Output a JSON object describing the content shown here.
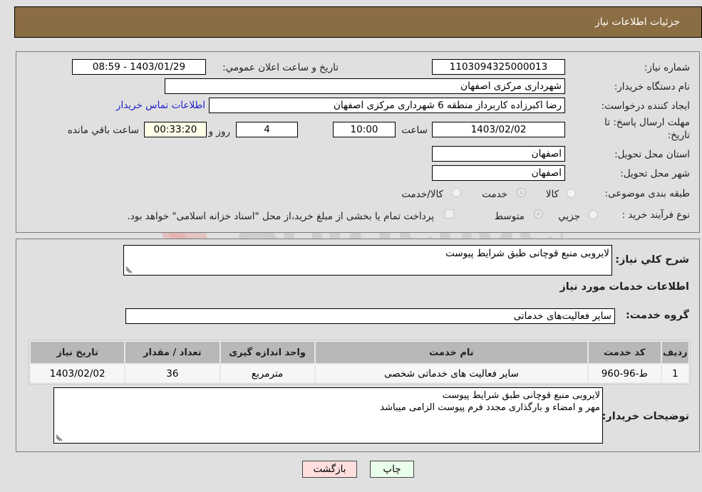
{
  "header": {
    "title": "جزئیات اطلاعات نیاز"
  },
  "form": {
    "need_number_label": "شماره نیاز:",
    "need_number": "1103094325000013",
    "announce_label": "تاريخ و ساعت اعلان عمومي:",
    "announce_value": "1403/01/29 - 08:59",
    "buyer_org_label": "نام دستگاه خريدار:",
    "buyer_org": "شهرداری مرکزی اصفهان",
    "creator_label": "ايجاد کننده درخواست:",
    "creator": "رضا اکبرزاده کاربرداز منطقه 6 شهرداری مرکزی اصفهان",
    "contact_link": "اطلاعات تماس خريدار",
    "deadline_label_1": "مهلت ارسال پاسخ: تا",
    "deadline_label_2": "تاريخ:",
    "deadline_date": "1403/02/02",
    "time_label": "ساعت",
    "deadline_time": "10:00",
    "days_value": "4",
    "days_label": "روز و",
    "remaining_time": "00:33:20",
    "remaining_label": "ساعت باقي مانده",
    "province_label": "استان محل تحويل:",
    "province": "اصفهان",
    "city_label": "شهر محل تحويل:",
    "city": "اصفهان",
    "category_label": "طبقه بندی موضوعی:",
    "category_options": [
      "کالا",
      "خدمت",
      "کالا/خدمت"
    ],
    "category_selected": "خدمت",
    "process_label": "نوع فرآيند خريد :",
    "process_options": [
      "جزيي",
      "متوسط"
    ],
    "process_selected": "متوسط",
    "treasury_note": "پرداخت تمام يا بخشی از مبلغ خريد،از محل \"اسناد خزانه اسلامی\" خواهد بود."
  },
  "details": {
    "summary_label": "شرح کلي نياز:",
    "summary": "لایروبی منبع قوچانی طبق شرایط پیوست",
    "services_heading": "اطلاعات خدمات مورد نياز",
    "service_group_label": "گروه خدمت:",
    "service_group": "سایر فعالیت‌های خدماتی",
    "table": {
      "headers": [
        "رديف",
        "کد خدمت",
        "نام خدمت",
        "واحد اندازه گيری",
        "تعداد / مقدار",
        "تاريخ نياز"
      ],
      "rows": [
        [
          "1",
          "ط-96-960",
          "سایر فعالیت های خدماتی شخصی",
          "مترمربع",
          "36",
          "1403/02/02"
        ]
      ]
    },
    "buyer_notes_label": "توضيحات خريدار:",
    "buyer_notes_line1": "لایروبی منبع قوچانی طبق شرایط پیوست",
    "buyer_notes_line2": "مهر و امضاء و بارگذاری مجدد فرم پیوست الزامی میباشد"
  },
  "buttons": {
    "print": "چاپ",
    "back": "بازگشت"
  },
  "colors": {
    "header_bg": "#8b6d43",
    "print_bg": "#eaffea",
    "back_bg": "#ffdede",
    "link": "#2222cc"
  }
}
